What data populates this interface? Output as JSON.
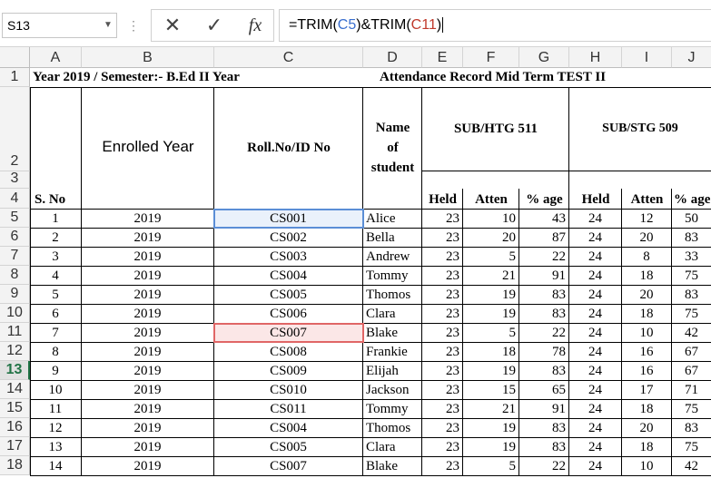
{
  "formula_bar": {
    "name_box": "S13",
    "separator": "⋮",
    "cancel_icon": "✕",
    "enter_icon": "✓",
    "function_icon": "fx",
    "formula_parts": [
      "=TRIM(",
      "C5",
      ")&TRIM(",
      "C11",
      ")"
    ]
  },
  "columns": [
    "A",
    "B",
    "C",
    "D",
    "E",
    "F",
    "G",
    "H",
    "I",
    "J"
  ],
  "row_numbers": [
    "1",
    "2",
    "3",
    "4",
    "5",
    "6",
    "7",
    "8",
    "9",
    "10",
    "11",
    "12",
    "13",
    "14",
    "15",
    "16",
    "17",
    "18"
  ],
  "sheet": {
    "title_left": "Year 2019 / Semester:- B.Ed II Year",
    "title_right": "Attendance Record Mid Term TEST II",
    "hdr_sno": "S. No",
    "hdr_enrolled": "Enrolled Year",
    "hdr_roll": "Roll.No/ID No",
    "hdr_name": [
      "Name",
      "of",
      "student"
    ],
    "hdr_sub1": "SUB/HTG 511",
    "hdr_sub2": "SUB/STG 509",
    "hdr_sub_cols": [
      "Held",
      "Atten",
      "% age",
      "Held",
      "Atten",
      "% age"
    ]
  },
  "rows": [
    [
      "1",
      "2019",
      "CS001",
      "Alice",
      "23",
      "10",
      "43",
      "24",
      "12",
      "50"
    ],
    [
      "2",
      "2019",
      "CS002",
      "Bella",
      "23",
      "20",
      "87",
      "24",
      "20",
      "83"
    ],
    [
      "3",
      "2019",
      "CS003",
      "Andrew",
      "23",
      "5",
      "22",
      "24",
      "8",
      "33"
    ],
    [
      "4",
      "2019",
      "CS004",
      "Tommy",
      "23",
      "21",
      "91",
      "24",
      "18",
      "75"
    ],
    [
      "5",
      "2019",
      "CS005",
      "Thomos",
      "23",
      "19",
      "83",
      "24",
      "20",
      "83"
    ],
    [
      "6",
      "2019",
      "CS006",
      "Clara",
      "23",
      "19",
      "83",
      "24",
      "18",
      "75"
    ],
    [
      "7",
      "2019",
      "CS007",
      " Blake",
      "23",
      "5",
      "22",
      "24",
      "10",
      "42"
    ],
    [
      "8",
      "2019",
      "CS008",
      "Frankie",
      "23",
      "18",
      "78",
      "24",
      "16",
      "67"
    ],
    [
      "9",
      "2019",
      "CS009",
      "Elijah",
      "23",
      "19",
      "83",
      "24",
      "16",
      "67"
    ],
    [
      "10",
      "2019",
      "CS010",
      "Jackson",
      "23",
      "15",
      "65",
      "24",
      "17",
      "71"
    ],
    [
      "11",
      "2019",
      "CS011",
      "Tommy",
      "23",
      "21",
      "91",
      "24",
      "18",
      "75"
    ],
    [
      "12",
      "2019",
      "CS004",
      "Thomos",
      "23",
      "19",
      "83",
      "24",
      "20",
      "83"
    ],
    [
      "13",
      "2019",
      "CS005",
      "Clara",
      "23",
      "19",
      "83",
      "24",
      "18",
      "75"
    ],
    [
      "14",
      "2019",
      "CS007",
      " Blake",
      "23",
      "5",
      "22",
      "24",
      "10",
      "42"
    ]
  ],
  "colors": {
    "ref_c5_fill": "#eaf1fb",
    "ref_c5_border": "#5b8ed6",
    "ref_c11_fill": "#fbe7e7",
    "ref_c11_border": "#e06666",
    "selected_row_header": "#217346"
  }
}
